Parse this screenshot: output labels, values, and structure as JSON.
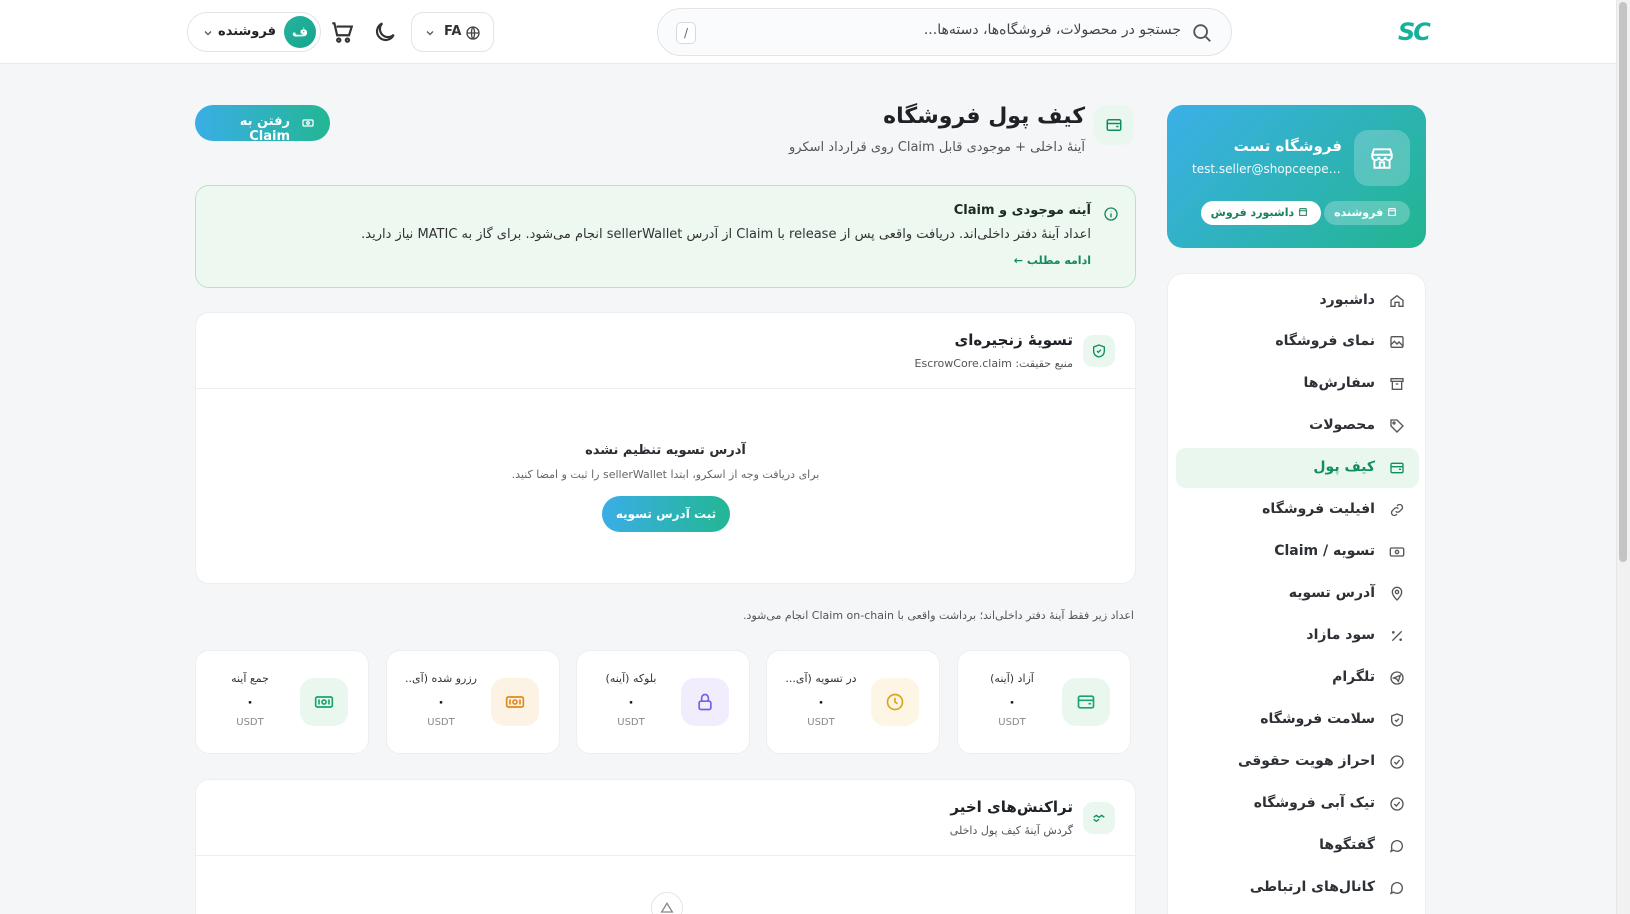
{
  "header": {
    "logo": "SC",
    "search_placeholder": "جستجو در محصولات، فروشگاه‌ها، دسته‌ها...",
    "search_shortcut": "/",
    "language": "FA",
    "user_initial": "ف",
    "user_role": "فروشنده"
  },
  "profile": {
    "store_name": "فروشگاه تست",
    "email": "test.seller@shopceeper.l...",
    "role_badge": "فروشنده",
    "dashboard_badge": "داشبورد فروش"
  },
  "sidebar": {
    "items": [
      {
        "label": "داشبورد",
        "icon": "home-icon"
      },
      {
        "label": "نمای فروشگاه",
        "icon": "image-icon"
      },
      {
        "label": "سفارش‌ها",
        "icon": "archive-icon"
      },
      {
        "label": "محصولات",
        "icon": "tag-icon"
      },
      {
        "label": "کیف پول",
        "icon": "wallet-icon",
        "active": true
      },
      {
        "label": "افیلیت فروشگاه",
        "icon": "link-icon"
      },
      {
        "label": "تسویه / Claim",
        "icon": "cash-icon"
      },
      {
        "label": "آدرس تسویه",
        "icon": "pin-icon"
      },
      {
        "label": "سود مازاد",
        "icon": "percent-icon"
      },
      {
        "label": "تلگرام",
        "icon": "telegram-icon"
      },
      {
        "label": "سلامت فروشگاه",
        "icon": "shield-icon"
      },
      {
        "label": "احراز هویت حقوقی",
        "icon": "check-circle-icon"
      },
      {
        "label": "تیک آبی فروشگاه",
        "icon": "badge-check-icon"
      },
      {
        "label": "گفتگوها",
        "icon": "chat-icon"
      },
      {
        "label": "کانال‌های ارتباطی",
        "icon": "message-icon"
      }
    ]
  },
  "page": {
    "title": "کیف پول فروشگاه",
    "subtitle": "آینهٔ داخلی + موجودی قابل Claim روی قرارداد اسکرو",
    "claim_button": "رفتن به Claim"
  },
  "notice": {
    "title": "آینه موجودی و Claim",
    "body": "اعداد آینهٔ دفتر داخلی‌اند. دریافت واقعی پس از release با Claim از آدرس sellerWallet انجام می‌شود. برای گاز به MATIC نیاز دارید.",
    "more": "ادامه مطلب ←"
  },
  "settlement": {
    "title": "تسویهٔ زنجیره‌ای",
    "subtitle": "منبع حقیقت: EscrowCore.claim",
    "empty_title": "آدرس تسویه تنظیم نشده",
    "empty_sub": "برای دریافت وجه از اسکرو، ابتدا sellerWallet را ثبت و امضا کنید.",
    "button": "ثبت آدرس تسویه"
  },
  "mirror_note": "اعداد زیر فقط آینهٔ دفتر داخلی‌اند؛ برداشت واقعی با Claim on-chain انجام می‌شود.",
  "stats": [
    {
      "label": "آزاد (آینه)",
      "value": "۰",
      "unit": "USDT",
      "icon": "wallet-icon",
      "color": "#18a56b",
      "bg": "#e9f7ef"
    },
    {
      "label": "در تسویه (آی...",
      "value": "۰",
      "unit": "USDT",
      "icon": "clock-icon",
      "color": "#e0a21c",
      "bg": "#fdf6e4"
    },
    {
      "label": "بلوکه (آینه)",
      "value": "۰",
      "unit": "USDT",
      "icon": "lock-icon",
      "color": "#7b5fe0",
      "bg": "#f1edfd"
    },
    {
      "label": "رزرو شده (آی...",
      "value": "۰",
      "unit": "USDT",
      "icon": "money-icon",
      "color": "#e08a1c",
      "bg": "#fdf3e4"
    },
    {
      "label": "جمع آینه",
      "value": "۰",
      "unit": "USDT",
      "icon": "money-icon",
      "color": "#18a56b",
      "bg": "#e9f7ef"
    }
  ],
  "transactions": {
    "title": "تراکنش‌های اخیر",
    "subtitle": "گردش آینهٔ کیف پول داخلی"
  }
}
